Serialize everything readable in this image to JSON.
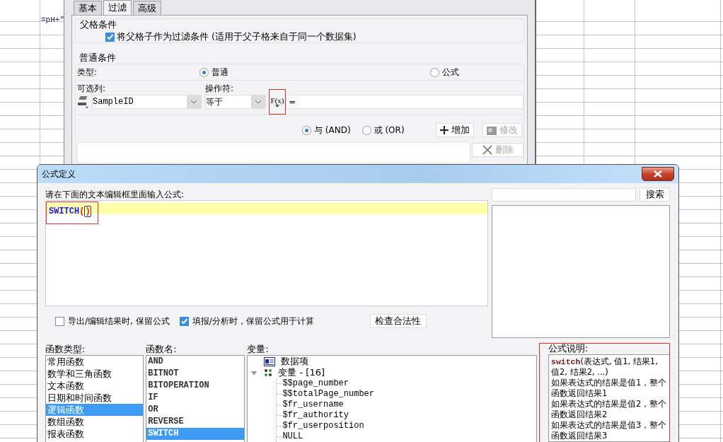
{
  "sheet_cell": "=pH+\"",
  "filter_dialog": {
    "tabs": [
      {
        "label": "基本",
        "selected": false
      },
      {
        "label": "过滤",
        "selected": true
      },
      {
        "label": "高级",
        "selected": false
      }
    ],
    "parent_group": {
      "title": "父格条件",
      "checkbox": {
        "label": "将父格子作为过滤条件 (适用于父子格来自于同一个数据集)",
        "checked": true
      }
    },
    "normal_group": {
      "title": "普通条件",
      "type_label": "类型:",
      "type_options": [
        {
          "label": "普通",
          "selected": true
        },
        {
          "label": "公式",
          "selected": false
        }
      ],
      "column_label": "可选列:",
      "operator_label": "操作符:",
      "column_value": "SampleID",
      "operator_value": "等于",
      "formula_button": {
        "label": "F(x)",
        "highlighted": true
      },
      "value": "=",
      "join_options": [
        {
          "label": "与",
          "suffix": "(AND)",
          "selected": true
        },
        {
          "label": "或",
          "suffix": "(OR)",
          "selected": false
        }
      ],
      "buttons": [
        {
          "kind": "add",
          "label": "增加",
          "disabled": false
        },
        {
          "kind": "edit",
          "label": "修改",
          "disabled": true
        },
        {
          "kind": "delete",
          "label": "删除",
          "disabled": true
        }
      ]
    }
  },
  "formula_dialog": {
    "title": "公式定义",
    "prompt": "请在下面的文本编辑框里面输入公式:",
    "formula": {
      "function": "SWITCH",
      "arguments": "()",
      "highlighted": true
    },
    "search_button": "搜索",
    "options": [
      {
        "label": "导出/编辑结果时, 保留公式",
        "checked": false
      },
      {
        "label": "填报/分析时，保留公式用于计算",
        "checked": true
      }
    ],
    "check_button": "检查合法性",
    "function_types": {
      "label": "函数类型:",
      "items": [
        {
          "label": "常用函数",
          "selected": false
        },
        {
          "label": "数学和三角函数",
          "selected": false
        },
        {
          "label": "文本函数",
          "selected": false
        },
        {
          "label": "日期和时间函数",
          "selected": false
        },
        {
          "label": "逻辑函数",
          "selected": true
        },
        {
          "label": "数组函数",
          "selected": false
        },
        {
          "label": "报表函数",
          "selected": false
        }
      ]
    },
    "function_names": {
      "label": "函数名:",
      "items": [
        {
          "label": "AND",
          "selected": false
        },
        {
          "label": "BITNOT",
          "selected": false
        },
        {
          "label": "BITOPERATION",
          "selected": false
        },
        {
          "label": "IF",
          "selected": false
        },
        {
          "label": "OR",
          "selected": false
        },
        {
          "label": "REVERSE",
          "selected": false
        },
        {
          "label": "SWITCH",
          "selected": true
        }
      ]
    },
    "variables": {
      "label": "变量:",
      "tree": [
        {
          "kind": "data",
          "label": "数据项"
        },
        {
          "kind": "group",
          "label": "变量 - [16]",
          "expanded": true,
          "children": [
            {
              "label": "$$page_number"
            },
            {
              "label": "$$totalPage_number"
            },
            {
              "label": "$fr_username"
            },
            {
              "label": "$fr_authority"
            },
            {
              "label": "$fr_userposition"
            },
            {
              "label": "NULL"
            }
          ]
        }
      ]
    },
    "description": {
      "label": "公式说明:",
      "highlighted": true,
      "lines": [
        "**switch**(表达式, 值1, 结果1, 值2, 结果2, ...)",
        "如果表达式的结果是值1，整个函数返回结果1",
        "如果表达式的结果是值2，整个函数返回结果2",
        "如果表达式的结果是值3，整个函数返回结果3"
      ]
    }
  }
}
